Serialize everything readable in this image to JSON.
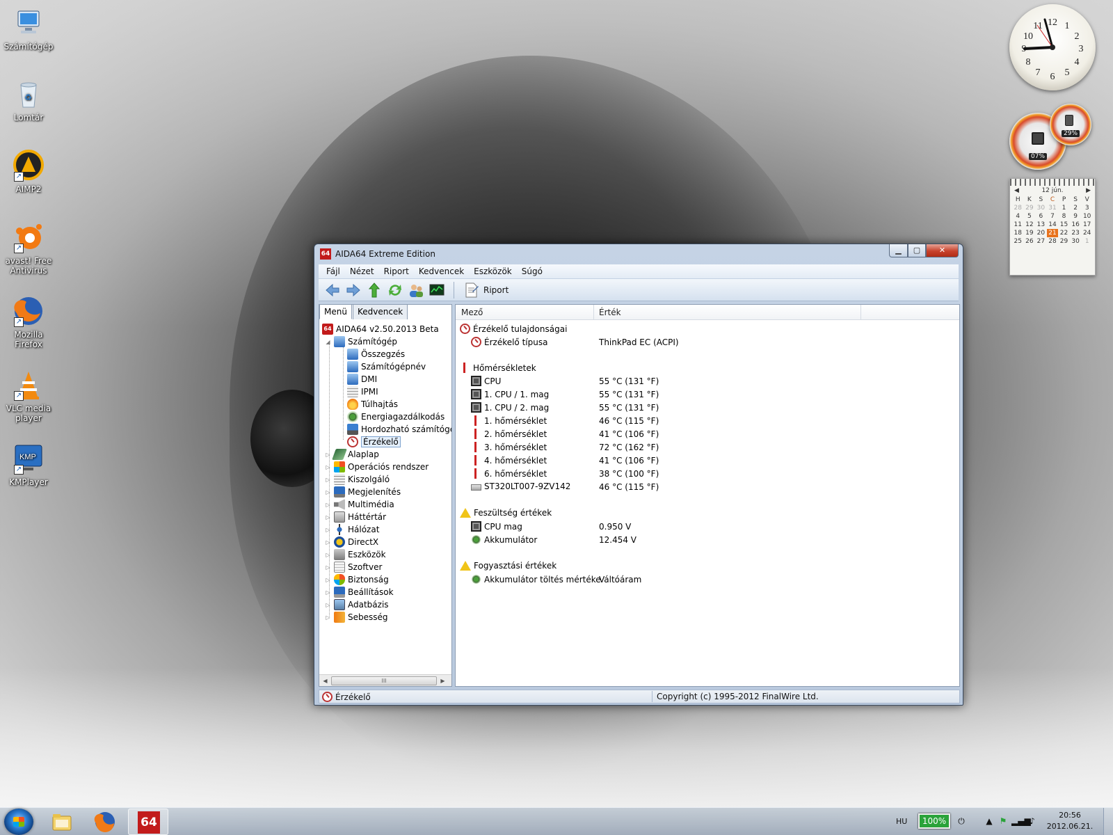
{
  "desktop": {
    "icons": [
      {
        "label": "Számítógép",
        "icon": "computer-icon"
      },
      {
        "label": "Lomtár",
        "icon": "recycle-bin-icon"
      },
      {
        "label": "AIMP2",
        "icon": "aimp-icon"
      },
      {
        "label": "avast! Free Antivirus",
        "icon": "avast-icon"
      },
      {
        "label": "Mozilla Firefox",
        "icon": "firefox-icon"
      },
      {
        "label": "VLC media player",
        "icon": "vlc-icon"
      },
      {
        "label": "KMPlayer",
        "icon": "kmplayer-icon"
      }
    ]
  },
  "gadgets": {
    "cpu_meter": {
      "cpu": "07%",
      "memory": "29%"
    },
    "calendar": {
      "month": "12 jún.",
      "weekdays": [
        "H",
        "K",
        "S",
        "C",
        "P",
        "S",
        "V"
      ],
      "weeks": [
        [
          "28",
          "29",
          "30",
          "31",
          "1",
          "2",
          "3"
        ],
        [
          "4",
          "5",
          "6",
          "7",
          "8",
          "9",
          "10"
        ],
        [
          "11",
          "12",
          "13",
          "14",
          "15",
          "16",
          "17"
        ],
        [
          "18",
          "19",
          "20",
          "21",
          "22",
          "23",
          "24"
        ],
        [
          "25",
          "26",
          "27",
          "28",
          "29",
          "30",
          "1"
        ]
      ]
    },
    "clock_numbers": [
      "12",
      "1",
      "2",
      "3",
      "4",
      "5",
      "6",
      "7",
      "8",
      "9",
      "10",
      "11"
    ]
  },
  "window": {
    "title": "AIDA64 Extreme Edition",
    "app_icon_text": "64",
    "menu": [
      "Fájl",
      "Nézet",
      "Riport",
      "Kedvencek",
      "Eszközök",
      "Súgó"
    ],
    "toolbar": {
      "report_label": "Riport"
    },
    "left_tabs": [
      "Menü",
      "Kedvencek"
    ],
    "tree": {
      "root": "AIDA64 v2.50.2013 Beta",
      "computer": "Számítógép",
      "computer_children": [
        "Összegzés",
        "Számítógépnév",
        "DMI",
        "IPMI",
        "Túlhajtás",
        "Energiagazdálkodás",
        "Hordozható számítógép",
        "Érzékelő"
      ],
      "top_level": [
        "Alaplap",
        "Operációs rendszer",
        "Kiszolgáló",
        "Megjelenítés",
        "Multimédia",
        "Háttértár",
        "Hálózat",
        "DirectX",
        "Eszközök",
        "Szoftver",
        "Biztonság",
        "Beállítások",
        "Adatbázis",
        "Sebesség"
      ],
      "scroll_thumb": "III"
    },
    "columns": {
      "field": "Mező",
      "value": "Érték"
    },
    "groups": [
      {
        "title": "Érzékelő tulajdonságai",
        "icon": "sensor-icon",
        "rows": [
          {
            "field": "Érzékelő típusa",
            "value": "ThinkPad EC  (ACPI)",
            "icon": "sensor-icon"
          }
        ]
      },
      {
        "title": "Hőmérsékletek",
        "icon": "thermometer-icon",
        "rows": [
          {
            "field": "CPU",
            "value": "55 °C  (131 °F)",
            "icon": "chip-icon"
          },
          {
            "field": "1. CPU / 1. mag",
            "value": "55 °C  (131 °F)",
            "icon": "chip-icon"
          },
          {
            "field": "1. CPU / 2. mag",
            "value": "55 °C  (131 °F)",
            "icon": "chip-icon"
          },
          {
            "field": "1. hőmérséklet",
            "value": "46 °C  (115 °F)",
            "icon": "thermometer-icon"
          },
          {
            "field": "2. hőmérséklet",
            "value": "41 °C  (106 °F)",
            "icon": "thermometer-icon"
          },
          {
            "field": "3. hőmérséklet",
            "value": "72 °C  (162 °F)",
            "icon": "thermometer-icon"
          },
          {
            "field": "4. hőmérséklet",
            "value": "41 °C  (106 °F)",
            "icon": "thermometer-icon"
          },
          {
            "field": "6. hőmérséklet",
            "value": "38 °C  (100 °F)",
            "icon": "thermometer-icon"
          },
          {
            "field": "ST320LT007-9ZV142",
            "value": "46 °C  (115 °F)",
            "icon": "hdd-icon"
          }
        ]
      },
      {
        "title": "Feszültség értékek",
        "icon": "warning-icon",
        "rows": [
          {
            "field": "CPU mag",
            "value": "0.950 V",
            "icon": "chip-icon"
          },
          {
            "field": "Akkumulátor",
            "value": "12.454 V",
            "icon": "battery-icon"
          }
        ]
      },
      {
        "title": "Fogyasztási értékek",
        "icon": "warning-icon",
        "rows": [
          {
            "field": "Akkumulátor töltés mértéke",
            "value": "Váltóáram",
            "icon": "battery-icon"
          }
        ]
      }
    ],
    "status": {
      "left": "Érzékelő",
      "right": "Copyright (c) 1995-2012 FinalWire Ltd."
    }
  },
  "taskbar": {
    "language": "HU",
    "battery": "100%",
    "time": "20:56",
    "date": "2012.06.21."
  }
}
